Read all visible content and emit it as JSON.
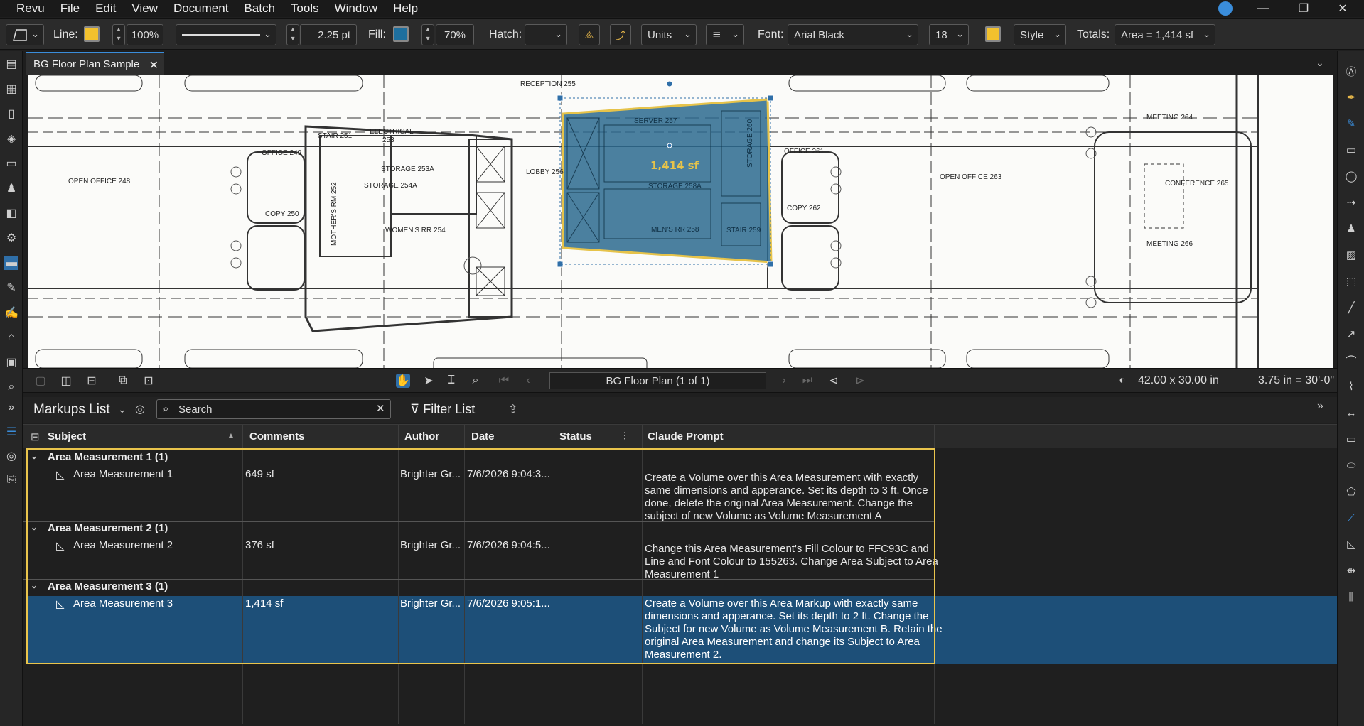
{
  "menu": {
    "items": [
      "Revu",
      "File",
      "Edit",
      "View",
      "Document",
      "Batch",
      "Tools",
      "Window",
      "Help"
    ]
  },
  "toolbar": {
    "line_label": "Line:",
    "line_color": "#f2c12e",
    "line_opacity": "100%",
    "line_width": "2.25 pt",
    "fill_label": "Fill:",
    "fill_color": "#1e6f9e",
    "fill_opacity": "70%",
    "hatch_label": "Hatch:",
    "units_label": "Units",
    "font_label": "Font:",
    "font_value": "Arial Black",
    "font_size": "18",
    "font_color": "#f2c12e",
    "style_label": "Style",
    "totals_label": "Totals:",
    "totals_value": "Area = 1,414 sf"
  },
  "tab": {
    "title": "BG Floor Plan Sample"
  },
  "plan": {
    "rooms": {
      "reception": "RECEPTION 255",
      "stair251": "STAIR 251",
      "electrical": "ELECTRICAL",
      "electrical_num": "253",
      "office249": "OFFICE 249",
      "open248": "OPEN OFFICE 248",
      "storage253a": "STORAGE 253A",
      "storage254a": "STORAGE 254A",
      "copy250": "COPY 250",
      "mothers": "MOTHER'S RM 252",
      "womens": "WOMEN'S RR 254",
      "lobby": "LOBBY 256",
      "server": "SERVER 257",
      "storage258a": "STORAGE 258A",
      "mens": "MEN'S RR 258",
      "stair259": "STAIR 259",
      "storage260": "STORAGE 260",
      "office261": "OFFICE 261",
      "copy262": "COPY 262",
      "open263": "OPEN OFFICE 263",
      "conference": "CONFERENCE 265",
      "meeting264": "MEETING 264",
      "meeting266": "MEETING 266"
    },
    "area_label": "1,414 sf",
    "area_fill": "#2b6a8f",
    "area_stroke": "#e6c34a"
  },
  "nav": {
    "page": "BG Floor Plan (1 of 1)",
    "dims": "42.00 x 30.00 in",
    "scale": "3.75 in = 30'-0\""
  },
  "markups": {
    "title": "Markups List",
    "search_placeholder": "Search",
    "filter": "Filter List",
    "columns": {
      "subject": "Subject",
      "comments": "Comments",
      "author": "Author",
      "date": "Date",
      "status": "Status",
      "prompt": "Claude Prompt"
    },
    "groups": [
      {
        "label": "Area Measurement 1 (1)",
        "subject": "Area Measurement 1",
        "comments": "649 sf",
        "author": "Brighter Gr...",
        "date": "7/6/2026 9:04:3...",
        "status": "",
        "prompt": "Create a Volume over this Area Measurement with exactly same dimensions and apperance. Set its depth to 3 ft. Once done, delete the original Area Measurement. Change the subject of new Volume as Volume Measurement A"
      },
      {
        "label": "Area Measurement 2 (1)",
        "subject": "Area Measurement 2",
        "comments": "376 sf",
        "author": "Brighter Gr...",
        "date": "7/6/2026 9:04:5...",
        "status": "",
        "prompt": "Change this Area Measurement's Fill Colour to FFC93C and Line and Font Colour to 155263. Change Area Subject to Area Measurement 1"
      },
      {
        "label": "Area Measurement 3 (1)",
        "subject": "Area Measurement 3",
        "comments": "1,414 sf",
        "author": "Brighter Gr...",
        "date": "7/6/2026 9:05:1...",
        "status": "",
        "prompt": "Create a Volume over this Area Markup with exactly same dimensions and apperance. Set its depth to 2 ft. Change the Subject for new Volume as Volume Measurement B. Retain the original Area Measurement and change its Subject to Area Measurement 2."
      }
    ],
    "selected_color": "#1d4f78",
    "highlight_color": "#e9c44c"
  }
}
